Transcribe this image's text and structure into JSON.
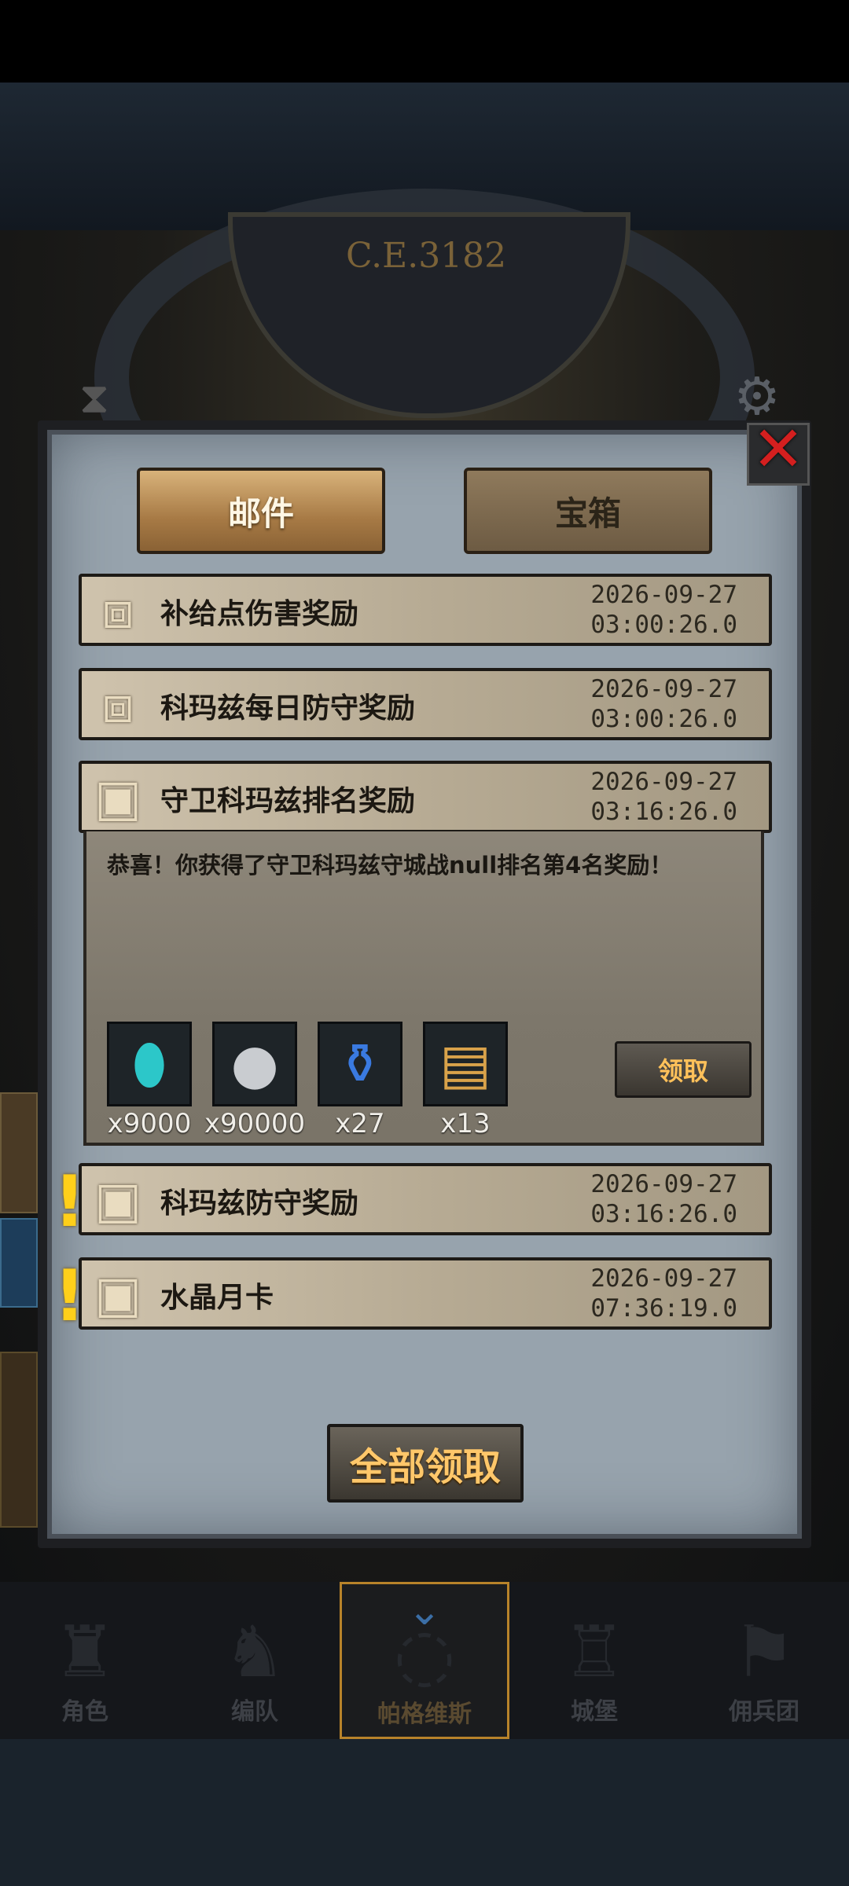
{
  "scene": {
    "year": "C.E.3182",
    "hourglass_icon": "hourglass-icon",
    "gear_icon": "gear-icon"
  },
  "tabs": [
    {
      "label": "邮件",
      "active": true
    },
    {
      "label": "宝箱",
      "active": false
    }
  ],
  "mails": [
    {
      "title": "补给点伤害奖励",
      "date": "2026-09-27",
      "time": "03:00:26.0",
      "icon": "opened-chest-icon",
      "unread": false
    },
    {
      "title": "科玛兹每日防守奖励",
      "date": "2026-09-27",
      "time": "03:00:26.0",
      "icon": "opened-chest-icon",
      "unread": false
    },
    {
      "title": "守卫科玛兹排名奖励",
      "date": "2026-09-27",
      "time": "03:16:26.0",
      "icon": "closed-chest-icon",
      "unread": false,
      "expanded": true
    },
    {
      "title": "科玛兹防守奖励",
      "date": "2026-09-27",
      "time": "03:16:26.0",
      "icon": "closed-chest-icon",
      "unread": true
    },
    {
      "title": "水晶月卡",
      "date": "2026-09-27",
      "time": "07:36:19.0",
      "icon": "closed-chest-icon",
      "unread": true
    }
  ],
  "expanded_mail": {
    "message": "恭喜！你获得了守卫科玛兹守城战null排名第4名奖励！",
    "rewards": [
      {
        "icon": "crystal-gem-icon",
        "qty": "x9000"
      },
      {
        "icon": "silver-coin-icon",
        "qty": "x90000"
      },
      {
        "icon": "blue-potion-icon",
        "qty": "x27"
      },
      {
        "icon": "treasure-chest-icon",
        "qty": "x13"
      }
    ],
    "claim_label": "领取"
  },
  "claim_all_label": "全部领取",
  "bottom_nav": [
    {
      "label": "角色",
      "icon": "knight-helmet-icon"
    },
    {
      "label": "编队",
      "icon": "squad-icon"
    },
    {
      "label": "帕格维斯",
      "icon": "portal-icon",
      "active": true
    },
    {
      "label": "城堡",
      "icon": "castle-icon"
    },
    {
      "label": "佣兵团",
      "icon": "mercenary-flag-icon"
    }
  ],
  "colors": {
    "panel": "#97a3ad",
    "tab_active": "#b88a52",
    "claim_text": "#ffc15a",
    "alert": "#ffcf1a",
    "close": "#d41f1f"
  }
}
